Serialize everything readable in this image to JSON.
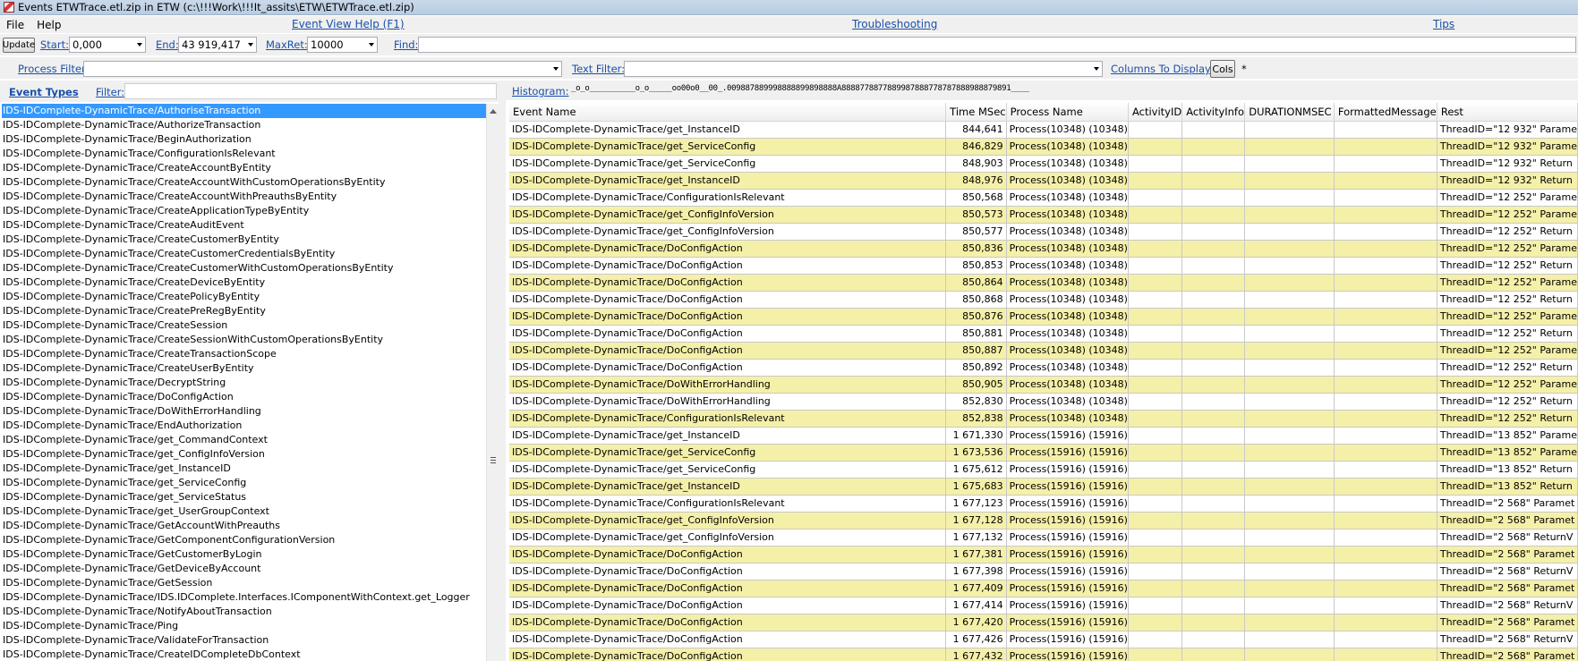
{
  "window": {
    "title": "Events ETWTrace.etl.zip in ETW (c:\\!!!Work\\!!!It_assits\\ETW\\ETWTrace.etl.zip)"
  },
  "menu": {
    "file": "File",
    "help": "Help",
    "event_view_help": "Event View Help (F1)",
    "troubleshooting": "Troubleshooting",
    "tips": "Tips"
  },
  "toolbar": {
    "update_label": "Update",
    "start_label": "Start:",
    "start_value": "0,000",
    "end_label": "End:",
    "end_value": "43 919,417",
    "maxret_label": "MaxRet:",
    "maxret_value": "10000",
    "find_label": "Find:",
    "find_value": "",
    "process_filter_label": "Process Filter:",
    "process_filter_value": "",
    "text_filter_label": "Text Filter:",
    "text_filter_value": "",
    "columns_label": "Columns To Display:",
    "cols_button": "Cols",
    "columns_value": "*"
  },
  "left_panel": {
    "event_types_label": "Event Types",
    "filter_label": "Filter:",
    "filter_value": "",
    "event_types": [
      "IDS-IDComplete-DynamicTrace/AuthoriseTransaction",
      "IDS-IDComplete-DynamicTrace/AuthorizeTransaction",
      "IDS-IDComplete-DynamicTrace/BeginAuthorization",
      "IDS-IDComplete-DynamicTrace/ConfigurationIsRelevant",
      "IDS-IDComplete-DynamicTrace/CreateAccountByEntity",
      "IDS-IDComplete-DynamicTrace/CreateAccountWithCustomOperationsByEntity",
      "IDS-IDComplete-DynamicTrace/CreateAccountWithPreauthsByEntity",
      "IDS-IDComplete-DynamicTrace/CreateApplicationTypeByEntity",
      "IDS-IDComplete-DynamicTrace/CreateAuditEvent",
      "IDS-IDComplete-DynamicTrace/CreateCustomerByEntity",
      "IDS-IDComplete-DynamicTrace/CreateCustomerCredentialsByEntity",
      "IDS-IDComplete-DynamicTrace/CreateCustomerWithCustomOperationsByEntity",
      "IDS-IDComplete-DynamicTrace/CreateDeviceByEntity",
      "IDS-IDComplete-DynamicTrace/CreatePolicyByEntity",
      "IDS-IDComplete-DynamicTrace/CreatePreRegByEntity",
      "IDS-IDComplete-DynamicTrace/CreateSession",
      "IDS-IDComplete-DynamicTrace/CreateSessionWithCustomOperationsByEntity",
      "IDS-IDComplete-DynamicTrace/CreateTransactionScope",
      "IDS-IDComplete-DynamicTrace/CreateUserByEntity",
      "IDS-IDComplete-DynamicTrace/DecryptString",
      "IDS-IDComplete-DynamicTrace/DoConfigAction",
      "IDS-IDComplete-DynamicTrace/DoWithErrorHandling",
      "IDS-IDComplete-DynamicTrace/EndAuthorization",
      "IDS-IDComplete-DynamicTrace/get_CommandContext",
      "IDS-IDComplete-DynamicTrace/get_ConfigInfoVersion",
      "IDS-IDComplete-DynamicTrace/get_InstanceID",
      "IDS-IDComplete-DynamicTrace/get_ServiceConfig",
      "IDS-IDComplete-DynamicTrace/get_ServiceStatus",
      "IDS-IDComplete-DynamicTrace/get_UserGroupContext",
      "IDS-IDComplete-DynamicTrace/GetAccountWithPreauths",
      "IDS-IDComplete-DynamicTrace/GetComponentConfigurationVersion",
      "IDS-IDComplete-DynamicTrace/GetCustomerByLogin",
      "IDS-IDComplete-DynamicTrace/GetDeviceByAccount",
      "IDS-IDComplete-DynamicTrace/GetSession",
      "IDS-IDComplete-DynamicTrace/IDS.IDComplete.Interfaces.IComponentWithContext.get_Logger",
      "IDS-IDComplete-DynamicTrace/NotifyAboutTransaction",
      "IDS-IDComplete-DynamicTrace/Ping",
      "IDS-IDComplete-DynamicTrace/ValidateForTransaction",
      "IDS-IDComplete-DynamicTrace/CreateIDCompleteDbContext"
    ]
  },
  "histogram": {
    "label": "Histogram:",
    "value": "_o_o__________o_o_____oo00o0__00_.009887889998888899898888A8888778877889987888778787888988879891____"
  },
  "grid": {
    "columns": [
      "Event Name",
      "Time MSec",
      "Process Name",
      "ActivityID",
      "ActivityInfo",
      "DURATIONMSEC",
      "FormattedMessage",
      "Rest"
    ],
    "rows": [
      [
        "IDS-IDComplete-DynamicTrace/get_InstanceID",
        "844,641",
        "Process(10348) (10348)",
        "ThreadID=\"12 932\" Parame"
      ],
      [
        "IDS-IDComplete-DynamicTrace/get_ServiceConfig",
        "846,829",
        "Process(10348) (10348)",
        "ThreadID=\"12 932\" Parame"
      ],
      [
        "IDS-IDComplete-DynamicTrace/get_ServiceConfig",
        "848,903",
        "Process(10348) (10348)",
        "ThreadID=\"12 932\" Return"
      ],
      [
        "IDS-IDComplete-DynamicTrace/get_InstanceID",
        "848,976",
        "Process(10348) (10348)",
        "ThreadID=\"12 932\" Return"
      ],
      [
        "IDS-IDComplete-DynamicTrace/ConfigurationIsRelevant",
        "850,568",
        "Process(10348) (10348)",
        "ThreadID=\"12 252\" Parame"
      ],
      [
        "IDS-IDComplete-DynamicTrace/get_ConfigInfoVersion",
        "850,573",
        "Process(10348) (10348)",
        "ThreadID=\"12 252\" Parame"
      ],
      [
        "IDS-IDComplete-DynamicTrace/get_ConfigInfoVersion",
        "850,577",
        "Process(10348) (10348)",
        "ThreadID=\"12 252\" Return"
      ],
      [
        "IDS-IDComplete-DynamicTrace/DoConfigAction",
        "850,836",
        "Process(10348) (10348)",
        "ThreadID=\"12 252\" Parame"
      ],
      [
        "IDS-IDComplete-DynamicTrace/DoConfigAction",
        "850,853",
        "Process(10348) (10348)",
        "ThreadID=\"12 252\" Return"
      ],
      [
        "IDS-IDComplete-DynamicTrace/DoConfigAction",
        "850,864",
        "Process(10348) (10348)",
        "ThreadID=\"12 252\" Parame"
      ],
      [
        "IDS-IDComplete-DynamicTrace/DoConfigAction",
        "850,868",
        "Process(10348) (10348)",
        "ThreadID=\"12 252\" Return"
      ],
      [
        "IDS-IDComplete-DynamicTrace/DoConfigAction",
        "850,876",
        "Process(10348) (10348)",
        "ThreadID=\"12 252\" Parame"
      ],
      [
        "IDS-IDComplete-DynamicTrace/DoConfigAction",
        "850,881",
        "Process(10348) (10348)",
        "ThreadID=\"12 252\" Return"
      ],
      [
        "IDS-IDComplete-DynamicTrace/DoConfigAction",
        "850,887",
        "Process(10348) (10348)",
        "ThreadID=\"12 252\" Parame"
      ],
      [
        "IDS-IDComplete-DynamicTrace/DoConfigAction",
        "850,892",
        "Process(10348) (10348)",
        "ThreadID=\"12 252\" Return"
      ],
      [
        "IDS-IDComplete-DynamicTrace/DoWithErrorHandling",
        "850,905",
        "Process(10348) (10348)",
        "ThreadID=\"12 252\" Parame"
      ],
      [
        "IDS-IDComplete-DynamicTrace/DoWithErrorHandling",
        "852,830",
        "Process(10348) (10348)",
        "ThreadID=\"12 252\" Return"
      ],
      [
        "IDS-IDComplete-DynamicTrace/ConfigurationIsRelevant",
        "852,838",
        "Process(10348) (10348)",
        "ThreadID=\"12 252\" Return"
      ],
      [
        "IDS-IDComplete-DynamicTrace/get_InstanceID",
        "1 671,330",
        "Process(15916) (15916)",
        "ThreadID=\"13 852\" Parame"
      ],
      [
        "IDS-IDComplete-DynamicTrace/get_ServiceConfig",
        "1 673,536",
        "Process(15916) (15916)",
        "ThreadID=\"13 852\" Parame"
      ],
      [
        "IDS-IDComplete-DynamicTrace/get_ServiceConfig",
        "1 675,612",
        "Process(15916) (15916)",
        "ThreadID=\"13 852\" Return"
      ],
      [
        "IDS-IDComplete-DynamicTrace/get_InstanceID",
        "1 675,683",
        "Process(15916) (15916)",
        "ThreadID=\"13 852\" Return"
      ],
      [
        "IDS-IDComplete-DynamicTrace/ConfigurationIsRelevant",
        "1 677,123",
        "Process(15916) (15916)",
        "ThreadID=\"2 568\" Paramet"
      ],
      [
        "IDS-IDComplete-DynamicTrace/get_ConfigInfoVersion",
        "1 677,128",
        "Process(15916) (15916)",
        "ThreadID=\"2 568\" Paramet"
      ],
      [
        "IDS-IDComplete-DynamicTrace/get_ConfigInfoVersion",
        "1 677,132",
        "Process(15916) (15916)",
        "ThreadID=\"2 568\" ReturnV"
      ],
      [
        "IDS-IDComplete-DynamicTrace/DoConfigAction",
        "1 677,381",
        "Process(15916) (15916)",
        "ThreadID=\"2 568\" Paramet"
      ],
      [
        "IDS-IDComplete-DynamicTrace/DoConfigAction",
        "1 677,398",
        "Process(15916) (15916)",
        "ThreadID=\"2 568\" ReturnV"
      ],
      [
        "IDS-IDComplete-DynamicTrace/DoConfigAction",
        "1 677,409",
        "Process(15916) (15916)",
        "ThreadID=\"2 568\" Paramet"
      ],
      [
        "IDS-IDComplete-DynamicTrace/DoConfigAction",
        "1 677,414",
        "Process(15916) (15916)",
        "ThreadID=\"2 568\" ReturnV"
      ],
      [
        "IDS-IDComplete-DynamicTrace/DoConfigAction",
        "1 677,420",
        "Process(15916) (15916)",
        "ThreadID=\"2 568\" Paramet"
      ],
      [
        "IDS-IDComplete-DynamicTrace/DoConfigAction",
        "1 677,426",
        "Process(15916) (15916)",
        "ThreadID=\"2 568\" ReturnV"
      ],
      [
        "IDS-IDComplete-DynamicTrace/DoConfigAction",
        "1 677,432",
        "Process(15916) (15916)",
        "ThreadID=\"2 568\" Paramet"
      ]
    ]
  },
  "colors": {
    "row_highlight": "#f5f0a8",
    "selection": "#3399ff",
    "link": "#1a4fa8"
  }
}
